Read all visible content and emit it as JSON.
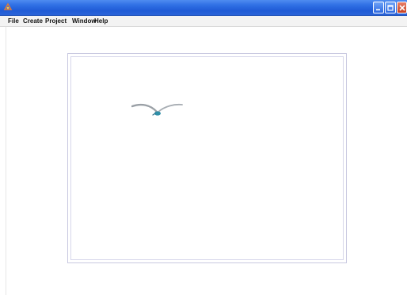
{
  "window": {
    "title": "",
    "controls": {
      "minimize_icon": "minimize-icon",
      "maximize_icon": "maximize-icon",
      "close_icon": "close-icon"
    }
  },
  "menubar": {
    "items": [
      {
        "label": "File"
      },
      {
        "label": "Create"
      },
      {
        "label": "Project"
      },
      {
        "label": "Window"
      },
      {
        "label": "Help"
      }
    ]
  },
  "canvas": {
    "sprite_icon": "bird-icon"
  },
  "colors": {
    "titlebar": "#2f6fe4",
    "close_button": "#c9401f",
    "bird_wing": "#9aa0a6",
    "bird_body": "#2f8fa8"
  }
}
